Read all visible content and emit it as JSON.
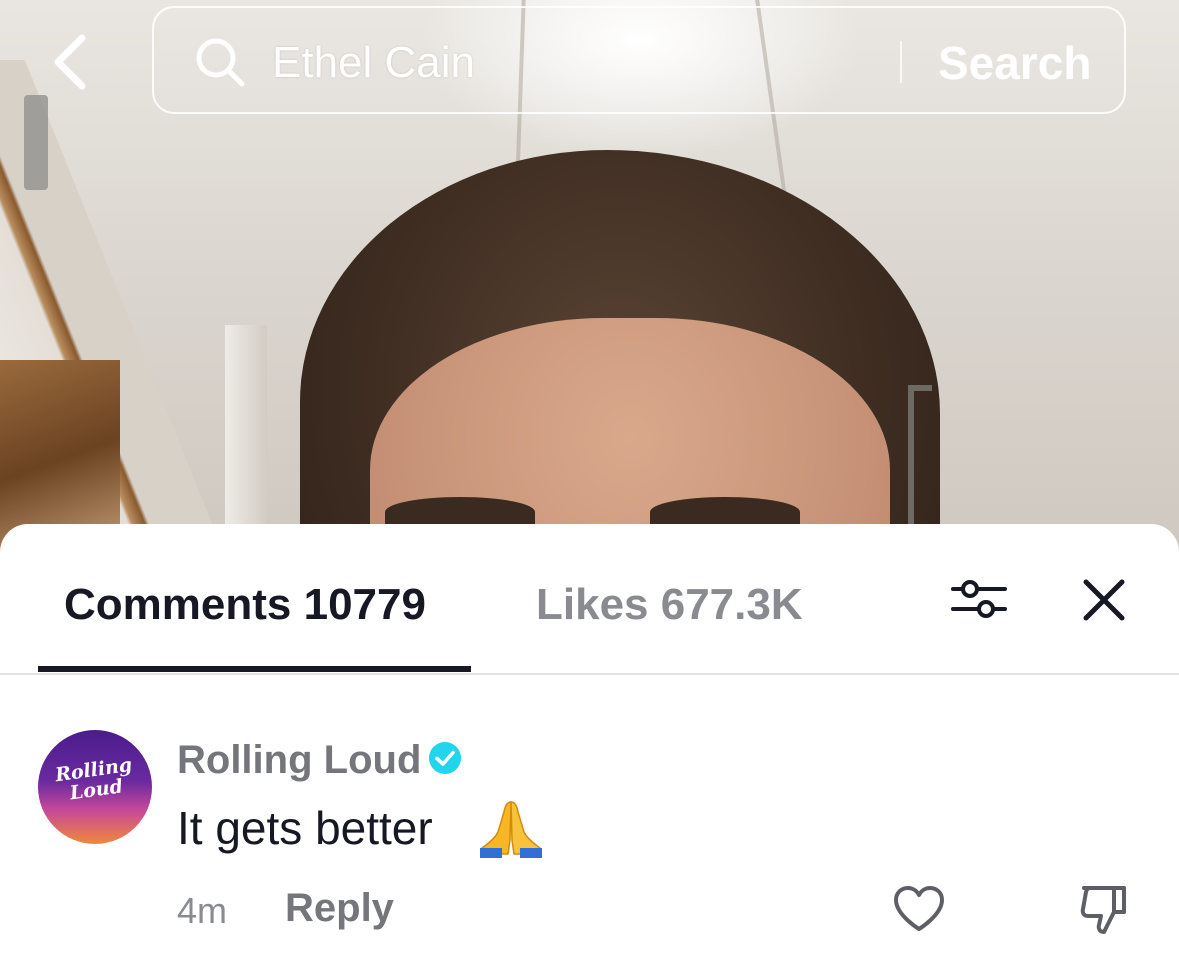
{
  "search": {
    "query": "Ethel Cain",
    "button_label": "Search"
  },
  "comments_panel": {
    "tabs": [
      {
        "label": "Comments 10779",
        "active": true
      },
      {
        "label": "Likes 677.3K",
        "active": false
      }
    ],
    "comment": {
      "author": "Rolling Loud",
      "verified": true,
      "avatar_text": "Rolling Loud",
      "text": "It gets better",
      "emoji": "folded-hands",
      "timestamp": "4m",
      "reply_label": "Reply"
    }
  },
  "icons": {
    "back": "chevron-left-icon",
    "search": "search-icon",
    "filter": "sliders-icon",
    "close": "close-icon",
    "verified": "verified-badge-icon",
    "like": "heart-icon",
    "dislike": "thumbs-down-icon"
  },
  "colors": {
    "text_primary": "#161823",
    "text_secondary": "#8a8b91",
    "verified": "#20d5ec"
  }
}
